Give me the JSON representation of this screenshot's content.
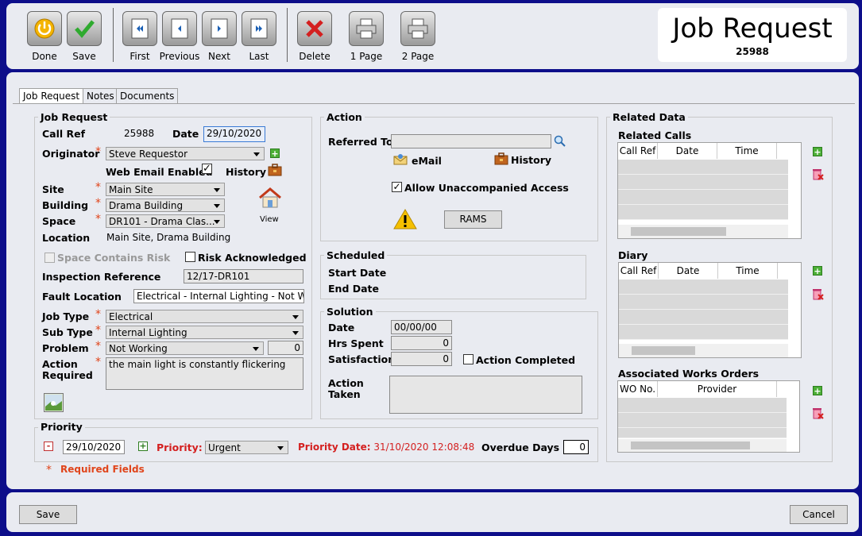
{
  "toolbar": {
    "done": "Done",
    "save": "Save",
    "first": "First",
    "previous": "Previous",
    "next": "Next",
    "last": "Last",
    "delete": "Delete",
    "one_page": "1 Page",
    "two_page": "2 Page"
  },
  "header": {
    "title": "Job Request",
    "number": "25988"
  },
  "tabs": [
    "Job Request",
    "Notes",
    "Documents"
  ],
  "job_request": {
    "legend": "Job Request",
    "call_ref_label": "Call Ref",
    "call_ref": "25988",
    "date_label": "Date",
    "date": "29/10/2020",
    "originator_label": "Originator",
    "originator": "Steve Requestor",
    "web_email_label": "Web Email Enabled",
    "history_label": "History",
    "site_label": "Site",
    "site": "Main Site",
    "building_label": "Building",
    "building": "Drama Building",
    "space_label": "Space",
    "space": "DR101 - Drama Clas...",
    "view_label": "View",
    "location_label": "Location",
    "location": "Main Site, Drama Building",
    "space_risk_label": "Space Contains Risk",
    "risk_ack_label": "Risk Acknowledged",
    "inspection_label": "Inspection Reference",
    "inspection": "12/17-DR101",
    "fault_label": "Fault Location",
    "fault": "Electrical - Internal Lighting - Not Working",
    "job_type_label": "Job Type",
    "job_type": "Electrical",
    "sub_type_label": "Sub Type",
    "sub_type": "Internal Lighting",
    "problem_label": "Problem",
    "problem": "Not Working",
    "problem_num": "0",
    "action_req_label1": "Action",
    "action_req_label2": "Required",
    "action_required": "the main light is constantly flickering"
  },
  "action": {
    "legend": "Action",
    "referred_label": "Referred To",
    "referred": "",
    "email_label": "eMail",
    "history_label": "History",
    "allow_label": "Allow Unaccompanied Access",
    "rams_label": "RAMS"
  },
  "scheduled": {
    "legend": "Scheduled",
    "start_label": "Start Date",
    "end_label": "End Date"
  },
  "solution": {
    "legend": "Solution",
    "date_label": "Date",
    "date": "00/00/00",
    "hrs_label": "Hrs Spent",
    "hrs": "0",
    "sat_label": "Satisfaction",
    "sat": "0",
    "completed_label": "Action Completed",
    "taken_label1": "Action",
    "taken_label2": "Taken"
  },
  "related": {
    "legend": "Related Data",
    "calls_title": "Related Calls",
    "calls_cols": [
      "Call Ref",
      "Date",
      "Time"
    ],
    "diary_title": "Diary",
    "diary_cols": [
      "Call Ref",
      "Date",
      "Time"
    ],
    "works_title": "Associated Works Orders",
    "works_cols": [
      "WO No.",
      "Provider"
    ]
  },
  "priority": {
    "legend": "Priority",
    "date": "29/10/2020",
    "priority_label": "Priority:",
    "priority": "Urgent",
    "pdate_label": "Priority Date:",
    "pdate": "31/10/2020 12:08:48",
    "overdue_label": "Overdue Days",
    "overdue": "0",
    "minus": "-",
    "plus": "+"
  },
  "required_note": "Required Fields",
  "footer": {
    "save": "Save",
    "cancel": "Cancel"
  },
  "colors": {
    "background": "#0d0e8a",
    "panel": "#e9ebf1",
    "required": "#e0441a"
  }
}
